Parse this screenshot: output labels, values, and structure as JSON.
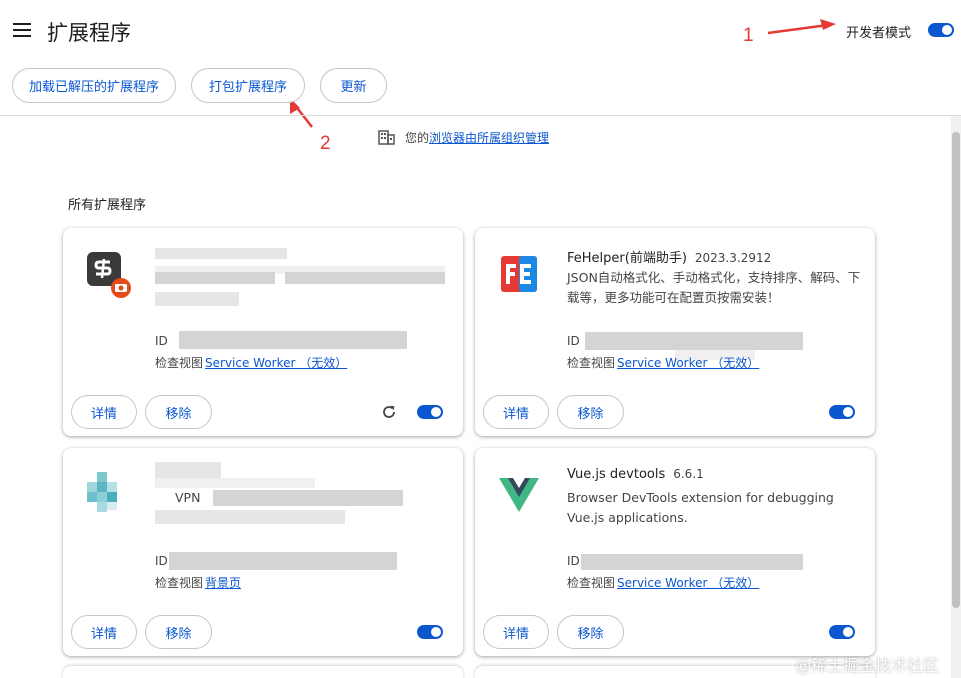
{
  "header": {
    "title": "扩展程序",
    "dev_mode_label": "开发者模式",
    "dev_mode_on": true
  },
  "toolbar": {
    "load_unpacked": "加载已解压的扩展程序",
    "pack": "打包扩展程序",
    "update": "更新"
  },
  "annotations": {
    "one": "1",
    "two": "2",
    "color": "#e53935"
  },
  "managed_notice": {
    "prefix": "您的",
    "link": "浏览器由所属组织管理"
  },
  "section_title": "所有扩展程序",
  "cards": [
    {
      "name": "",
      "version": "",
      "description": "",
      "id_label": "ID",
      "inspect_label": "检查视图",
      "inspect_link": "Service Worker （无效）",
      "details": "详情",
      "remove": "移除",
      "enabled": true,
      "icon": "sublime-screenshot-icon"
    },
    {
      "name": "FeHelper(前端助手)",
      "version": "2023.3.2912",
      "description": "JSON自动格式化、手动格式化，支持排序、解码、下载等，更多功能可在配置页按需安装！",
      "id_label": "ID",
      "inspect_label": "检查视图",
      "inspect_link": "Service Worker （无效）",
      "details": "详情",
      "remove": "移除",
      "enabled": true,
      "icon": "fehelper-fe-icon"
    },
    {
      "name": "",
      "version": "",
      "description": "VPN",
      "id_label": "ID",
      "inspect_label": "检查视图",
      "inspect_link": "背景页",
      "details": "详情",
      "remove": "移除",
      "enabled": true,
      "icon": "vpn-pixel-icon"
    },
    {
      "name": "Vue.js devtools",
      "version": "6.6.1",
      "description": "Browser DevTools extension for debugging Vue.js applications.",
      "id_label": "ID",
      "inspect_label": "检查视图",
      "inspect_link": "Service Worker （无效）",
      "details": "详情",
      "remove": "移除",
      "enabled": true,
      "icon": "vue-logo-icon"
    }
  ],
  "watermark": "@稀土掘金技术社区",
  "colors": {
    "accent": "#0b57d0",
    "border": "#c4c7c5"
  }
}
